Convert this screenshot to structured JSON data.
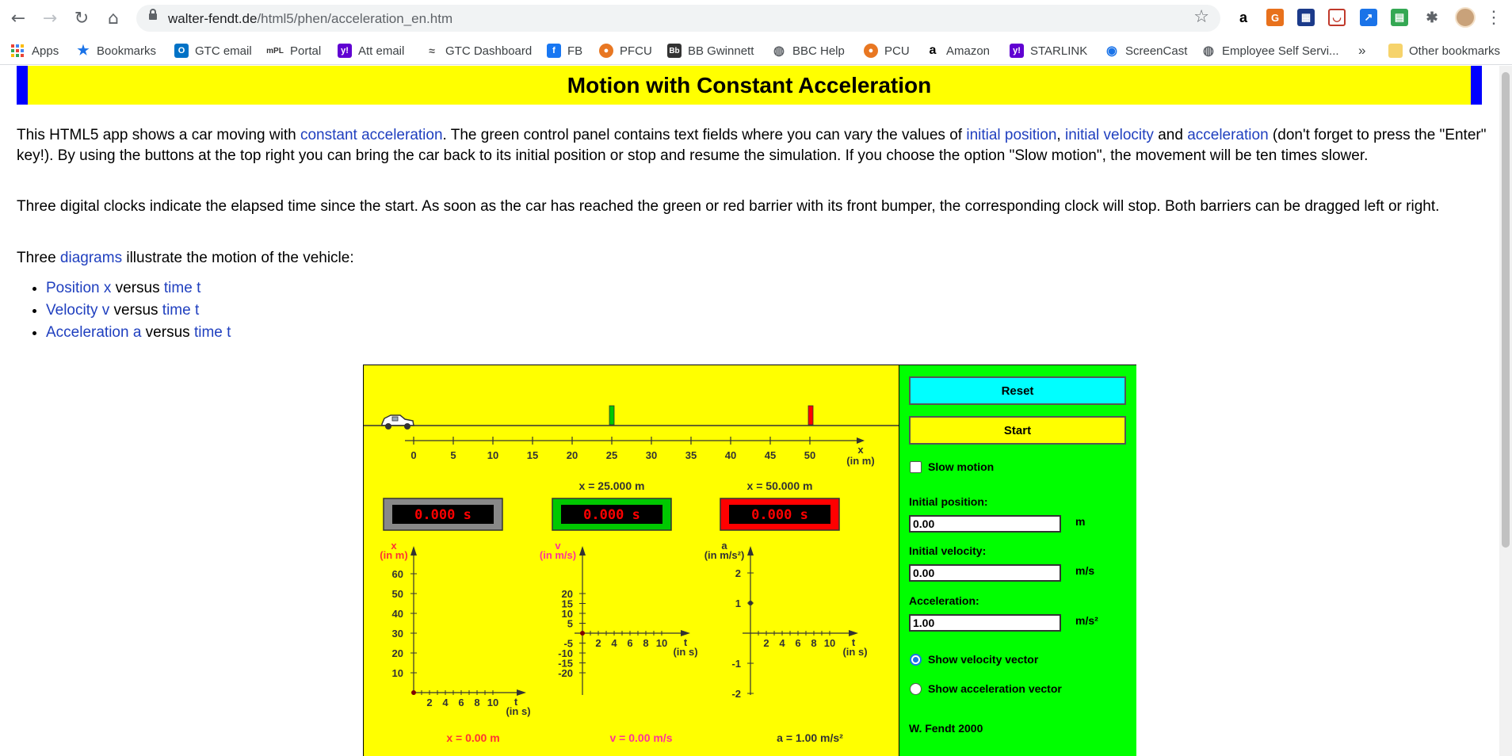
{
  "browser": {
    "url_host": "walter-fendt.de",
    "url_path": "/html5/phen/acceleration_en.htm",
    "bookmarks": [
      {
        "label": "Apps"
      },
      {
        "label": "Bookmarks"
      },
      {
        "label": "GTC email"
      },
      {
        "label": "Portal"
      },
      {
        "label": "Att email"
      },
      {
        "label": "GTC Dashboard"
      },
      {
        "label": "FB"
      },
      {
        "label": "PFCU"
      },
      {
        "label": "BB Gwinnett"
      },
      {
        "label": "BBC Help"
      },
      {
        "label": "PCU"
      },
      {
        "label": "Amazon"
      },
      {
        "label": "STARLINK"
      },
      {
        "label": "ScreenCast"
      },
      {
        "label": "Employee Self Servi..."
      }
    ],
    "overflow": "»",
    "other_bookmarks": "Other bookmarks"
  },
  "page": {
    "title": "Motion with Constant Acceleration",
    "p1": {
      "t1": "This HTML5 app shows a car moving with ",
      "l1": "constant acceleration",
      "t2": ". The green control panel contains text fields where you can vary the values of ",
      "l2": "initial position",
      "t3": ", ",
      "l3": "initial velocity",
      "t4": " and ",
      "l4": "acceleration",
      "t5": " (don't forget to press the \"Enter\" key!). By using the buttons at the top right you can bring the car back to its initial position or stop and resume the simulation. If you choose the option \"Slow motion\", the movement will be ten times slower."
    },
    "p2": "Three digital clocks indicate the elapsed time since the start. As soon as the car has reached the green or red barrier with its front bumper, the corresponding clock will stop. Both barriers can be dragged left or right.",
    "p3": {
      "t1": "Three ",
      "l1": "diagrams",
      "t2": " illustrate the motion of the vehicle:"
    },
    "list": [
      {
        "a": "Position x",
        "b": " versus ",
        "c": "time t"
      },
      {
        "a": "Velocity v",
        "b": " versus ",
        "c": "time t"
      },
      {
        "a": "Acceleration a",
        "b": " versus ",
        "c": "time t"
      }
    ]
  },
  "applet": {
    "track_ticks": [
      "0",
      "5",
      "10",
      "15",
      "20",
      "25",
      "30",
      "35",
      "40",
      "45",
      "50"
    ],
    "track_axis_label": "x",
    "track_axis_unit": "(in m)",
    "green_barrier_label": "x = 25.000 m",
    "red_barrier_label": "x = 50.000 m",
    "clock_main": "0.000 s",
    "clock_green": "0.000 s",
    "clock_red": "0.000 s",
    "colors": {
      "sim_bg": "#ffff00",
      "panel_bg": "#00ff00",
      "green_clock": "#00c800",
      "red_clock": "#ff0000",
      "reset_button": "#00ffff",
      "clock_digits": "#ff0000"
    },
    "diagram_x": {
      "ylabel": "x",
      "yunit": "(in m)",
      "yticks": [
        "60",
        "50",
        "40",
        "30",
        "20",
        "10"
      ],
      "xticks": [
        "2",
        "4",
        "6",
        "8",
        "10"
      ],
      "xlabel": "t",
      "xunit": "(in s)",
      "readout": "x = 0.00 m"
    },
    "diagram_v": {
      "ylabel": "v",
      "yunit": "(in m/s)",
      "yticks_pos": [
        "20",
        "15",
        "10",
        "5"
      ],
      "yticks_neg": [
        "-5",
        "-10",
        "-15",
        "-20"
      ],
      "xticks": [
        "2",
        "4",
        "6",
        "8",
        "10"
      ],
      "xlabel": "t",
      "xunit": "(in s)",
      "readout": "v = 0.00 m/s"
    },
    "diagram_a": {
      "ylabel": "a",
      "yunit": "(in m/s²)",
      "yticks_pos": [
        "2",
        "1"
      ],
      "yticks_neg": [
        "-1",
        "-2"
      ],
      "xticks": [
        "2",
        "4",
        "6",
        "8",
        "10"
      ],
      "xlabel": "t",
      "xunit": "(in s)",
      "readout": "a = 1.00 m/s²"
    },
    "panel": {
      "reset": "Reset",
      "start": "Start",
      "slow_motion": "Slow motion",
      "slow_motion_checked": false,
      "initial_position_label": "Initial position:",
      "initial_position_value": "0.00",
      "initial_position_unit": "m",
      "initial_velocity_label": "Initial velocity:",
      "initial_velocity_value": "0.00",
      "initial_velocity_unit": "m/s",
      "acceleration_label": "Acceleration:",
      "acceleration_value": "1.00",
      "acceleration_unit": "m/s²",
      "show_velocity": "Show velocity vector",
      "show_velocity_selected": true,
      "show_acceleration": "Show acceleration vector",
      "show_acceleration_selected": false,
      "credit": "W. Fendt 2000"
    }
  }
}
